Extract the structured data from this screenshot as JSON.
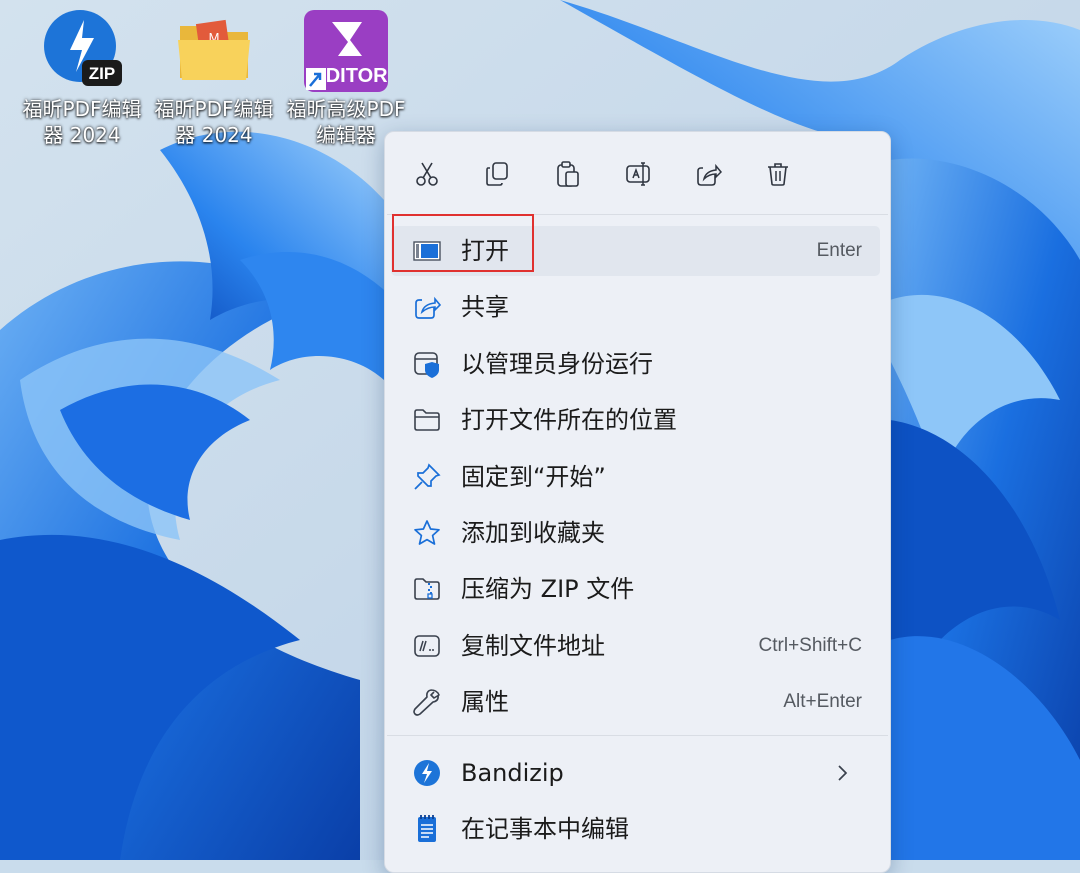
{
  "desktop": {
    "icons": [
      {
        "name": "福昕PDF编辑\n器 2024",
        "badge": "ZIP",
        "type": "bandizip"
      },
      {
        "name": "福昕PDF编辑\n器 2024",
        "type": "folder"
      },
      {
        "name": "福昕高级PDF\n编辑器",
        "badge": "EDITOR",
        "type": "editor-shortcut"
      }
    ]
  },
  "context_menu": {
    "toolbar": [
      "cut-icon",
      "copy-icon",
      "paste-icon",
      "rename-icon",
      "share-icon",
      "delete-icon"
    ],
    "items": [
      {
        "label": "打开",
        "shortcut": "Enter",
        "icon": "open-window-icon",
        "highlighted": true
      },
      {
        "label": "共享",
        "shortcut": "",
        "icon": "share-icon"
      },
      {
        "label": "以管理员身份运行",
        "shortcut": "",
        "icon": "admin-shield-icon"
      },
      {
        "label": "打开文件所在的位置",
        "shortcut": "",
        "icon": "folder-icon"
      },
      {
        "label": "固定到“开始”",
        "shortcut": "",
        "icon": "pin-icon"
      },
      {
        "label": "添加到收藏夹",
        "shortcut": "",
        "icon": "star-icon"
      },
      {
        "label": "压缩为 ZIP 文件",
        "shortcut": "",
        "icon": "zip-folder-icon"
      },
      {
        "label": "复制文件地址",
        "shortcut": "Ctrl+Shift+C",
        "icon": "copy-path-icon"
      },
      {
        "label": "属性",
        "shortcut": "Alt+Enter",
        "icon": "wrench-icon"
      }
    ],
    "extra_items": [
      {
        "label": "Bandizip",
        "icon": "bandizip-icon",
        "submenu": true
      },
      {
        "label": "在记事本中编辑",
        "icon": "notepad-icon"
      }
    ]
  },
  "colors": {
    "accent_blue": "#1a6fd8",
    "highlight_border": "#e0312f",
    "menu_bg": "#edf0f6"
  }
}
